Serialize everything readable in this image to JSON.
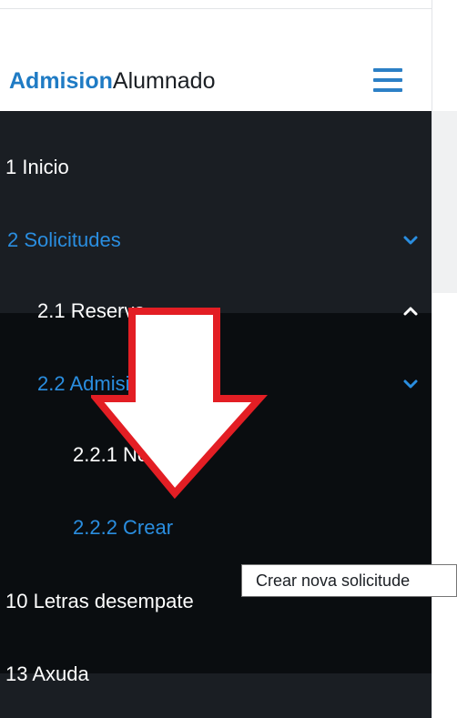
{
  "header": {
    "brand_accent": "Admision",
    "brand_rest": "Alumnado",
    "menu_icon": "hamburger-icon"
  },
  "nav": {
    "item_1": "1 Inicio",
    "item_2": "2 Solicitudes",
    "item_2_1": "2.1 Reserva",
    "item_2_2": "2.2 Admisión",
    "item_2_2_1": "2.2.1 Non crear",
    "item_2_2_2": "2.2.2 Crear",
    "item_10": "10 Letras desempate",
    "item_13": "13 Axuda"
  },
  "tooltip": {
    "text": "Crear nova solicitude"
  },
  "colors": {
    "brand_blue": "#1f7bc4",
    "active_blue": "#2a8ee0",
    "sidebar_bg": "#1a1e23",
    "submenu_bg": "#0a0d10",
    "arrow_red": "#e31e24"
  }
}
